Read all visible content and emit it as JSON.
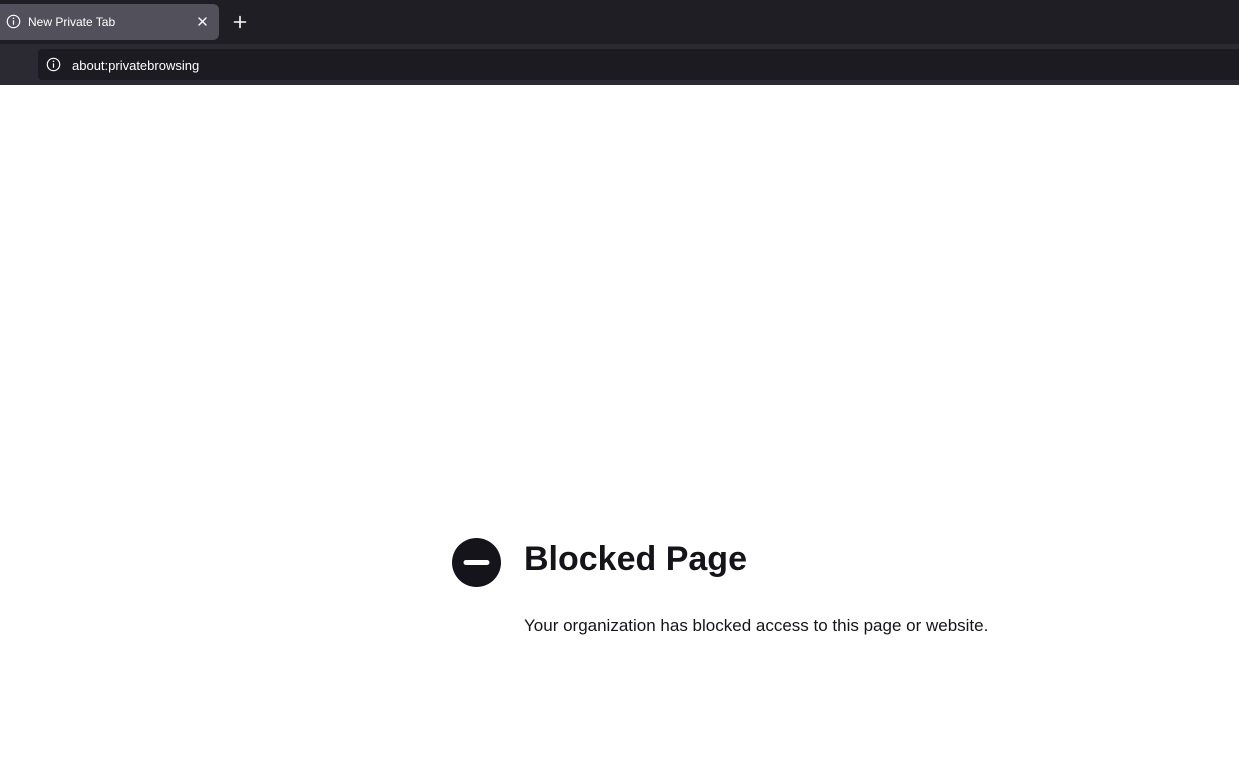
{
  "browser": {
    "tab": {
      "title": "New Private Tab",
      "icon": "info-icon",
      "close_icon": "close-icon"
    },
    "new_tab_icon": "plus-icon",
    "address_bar": {
      "icon": "info-icon",
      "url": "about:privatebrowsing"
    },
    "colors": {
      "tab_strip_background": "#1f1e25",
      "selected_tab_background": "#52505a",
      "toolbar_background": "#2b2a33",
      "address_bar_background": "#1c1b22",
      "chrome_text": "#ffffff"
    }
  },
  "page": {
    "icon": "blocked-icon",
    "title": "Blocked Page",
    "message": "Your organization has blocked access to this page or website.",
    "colors": {
      "background": "#ffffff",
      "text": "#15141a",
      "icon": "#15141a"
    }
  }
}
